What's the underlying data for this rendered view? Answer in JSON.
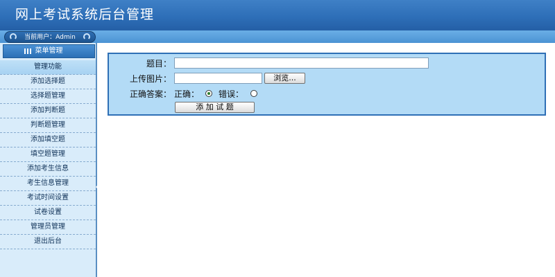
{
  "header": {
    "title": "网上考试系统后台管理"
  },
  "user_bar": {
    "label": "当前用户：Admin"
  },
  "menu": {
    "head_label": "菜单管理",
    "items": [
      {
        "label": "管理功能"
      },
      {
        "label": "添加选择题"
      },
      {
        "label": "选择题管理"
      },
      {
        "label": "添加判断题"
      },
      {
        "label": "判断题管理"
      },
      {
        "label": "添加填空题"
      },
      {
        "label": "填空题管理"
      },
      {
        "label": "添加考生信息"
      },
      {
        "label": "考生信息管理"
      },
      {
        "label": "考试时间设置"
      },
      {
        "label": "试卷设置"
      },
      {
        "label": "管理员管理"
      },
      {
        "label": "退出后台"
      }
    ]
  },
  "form": {
    "question_label": "题目：",
    "question_value": "",
    "image_label": "上传图片：",
    "image_value": "",
    "browse_label": "浏览...",
    "answer_label": "正确答案：",
    "correct_label": "正确：",
    "wrong_label": "错误：",
    "selected_answer": "correct",
    "submit_label": "添 加 试 题"
  },
  "colors": {
    "header_blue": "#2e6fb8",
    "panel_bg": "#b3dbf6",
    "sidebar_bg": "#d9ecfa"
  }
}
